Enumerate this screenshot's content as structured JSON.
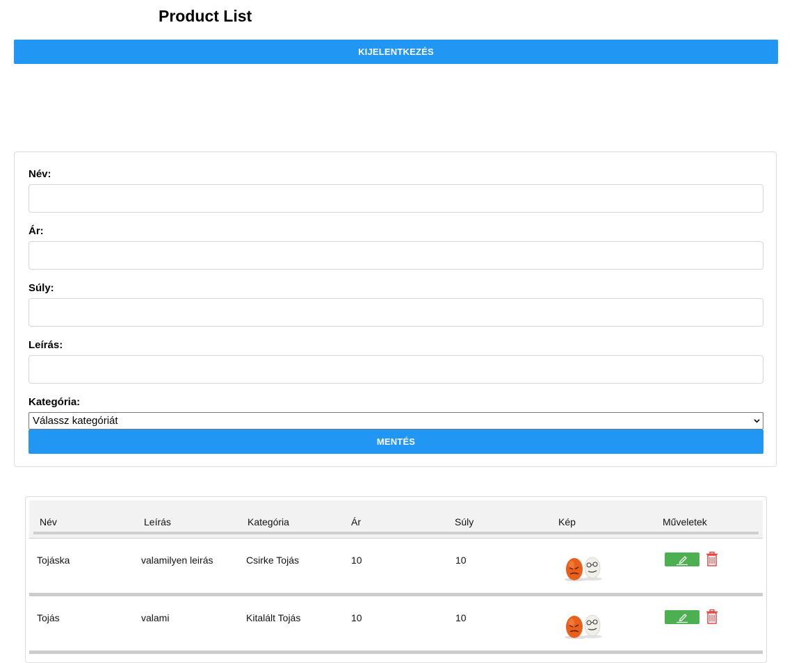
{
  "page": {
    "title": "Product List"
  },
  "header": {
    "logout_label": "KIJELENTKEZÉS"
  },
  "form": {
    "name_label": "Név:",
    "name_value": "",
    "price_label": "Ár:",
    "price_value": "",
    "weight_label": "Súly:",
    "weight_value": "",
    "description_label": "Leírás:",
    "description_value": "",
    "category_label": "Kategória:",
    "category_selected": "Válassz kategóriát",
    "save_label": "MENTÉS"
  },
  "table": {
    "headers": [
      "Név",
      "Leírás",
      "Kategória",
      "Ár",
      "Súly",
      "Kép",
      "Műveletek"
    ],
    "rows": [
      {
        "name": "Tojáska",
        "description": "valamilyen leirás",
        "category": "Csirke Tojás",
        "price": "10",
        "weight": "10",
        "image_icon": "eggs-image",
        "edit_icon": "pencil-icon",
        "delete_icon": "trash-icon"
      },
      {
        "name": "Tojás",
        "description": "valami",
        "category": "Kitalált Tojás",
        "price": "10",
        "weight": "10",
        "image_icon": "eggs-image",
        "edit_icon": "pencil-icon",
        "delete_icon": "trash-icon"
      }
    ]
  },
  "colors": {
    "primary": "#2196f3",
    "edit": "#4caf50",
    "delete": "#e53935",
    "header_bg": "#f2f2f2"
  }
}
